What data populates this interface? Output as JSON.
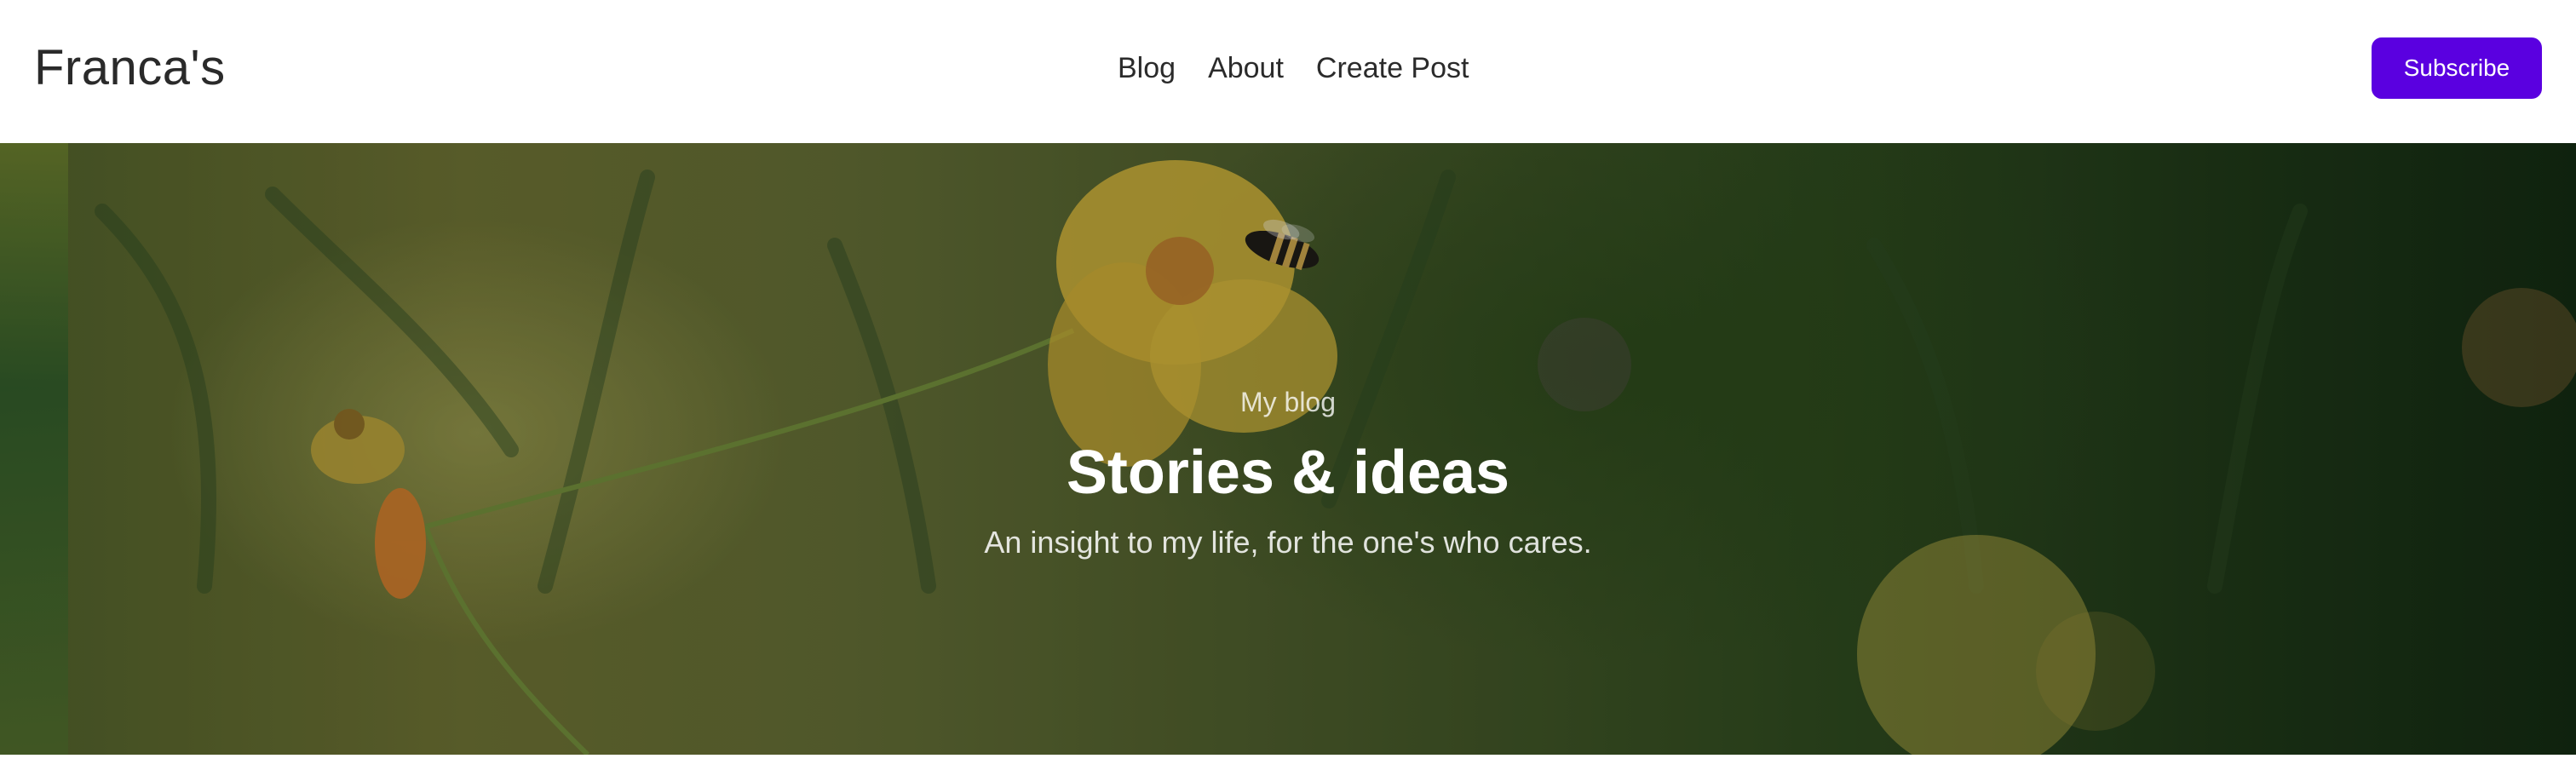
{
  "header": {
    "site_title": "Franca's",
    "nav": [
      {
        "label": "Blog"
      },
      {
        "label": "About"
      },
      {
        "label": "Create Post"
      }
    ],
    "subscribe_label": "Subscribe",
    "accent_color": "#5a00e0"
  },
  "hero": {
    "eyebrow": "My blog",
    "title": "Stories & ideas",
    "subtitle": "An insight to my life, for the one's who cares."
  }
}
